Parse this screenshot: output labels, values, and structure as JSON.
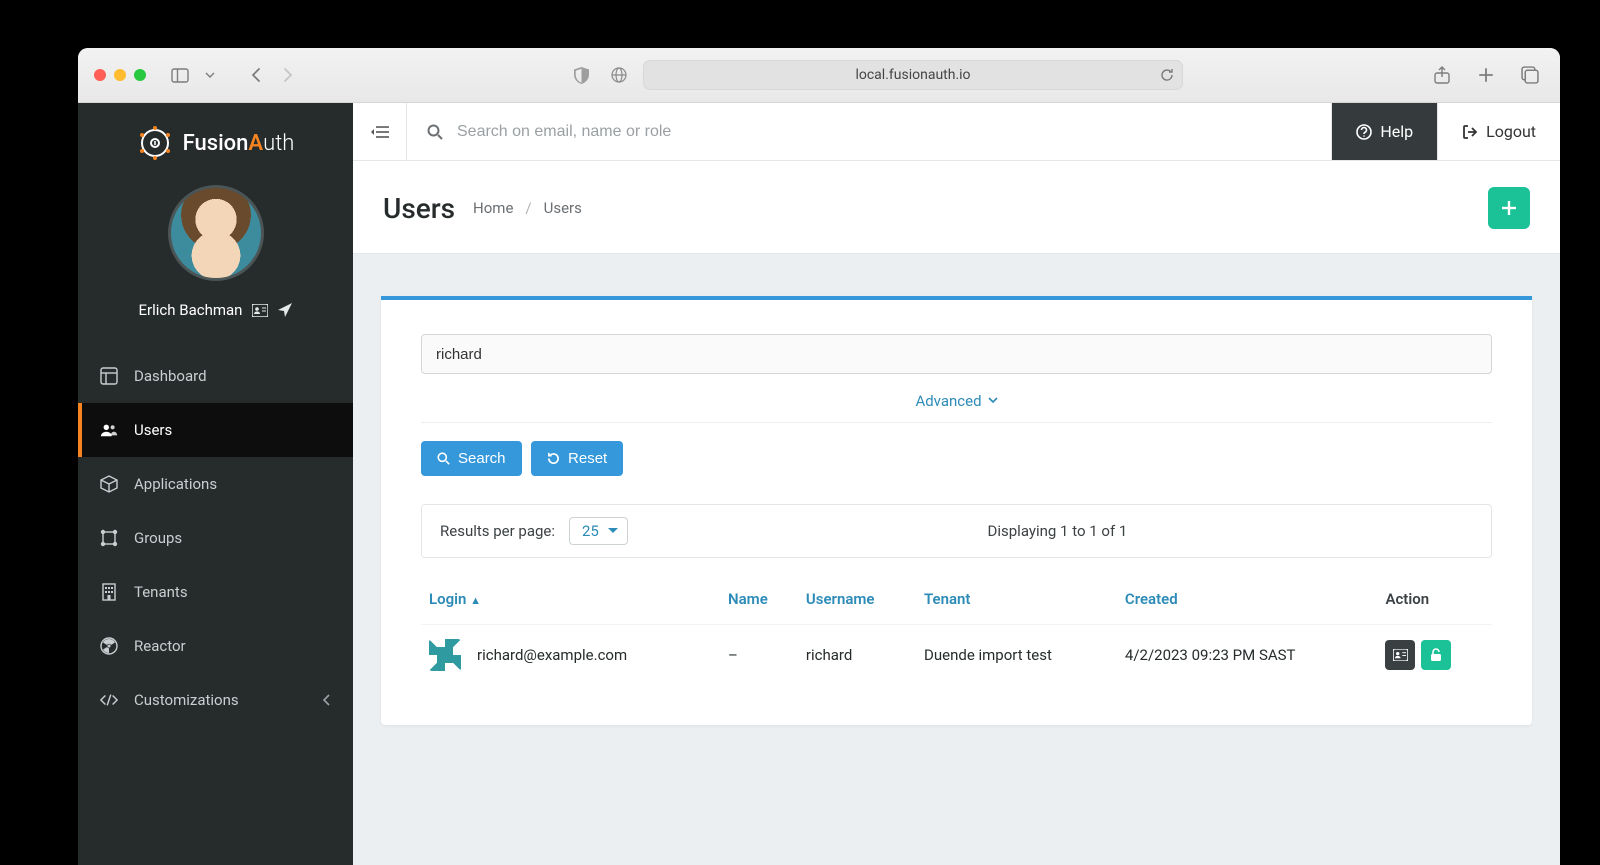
{
  "browser": {
    "address": "local.fusionauth.io"
  },
  "brand": {
    "name_a": "Fusion",
    "name_b": "A",
    "name_c": "uth"
  },
  "profile": {
    "name": "Erlich Bachman"
  },
  "sidebar": {
    "items": [
      {
        "label": "Dashboard",
        "icon": "dashboard"
      },
      {
        "label": "Users",
        "icon": "users",
        "active": true
      },
      {
        "label": "Applications",
        "icon": "cube"
      },
      {
        "label": "Groups",
        "icon": "groups"
      },
      {
        "label": "Tenants",
        "icon": "building"
      },
      {
        "label": "Reactor",
        "icon": "reactor"
      },
      {
        "label": "Customizations",
        "icon": "code",
        "expandable": true
      }
    ]
  },
  "topbar": {
    "search_placeholder": "Search on email, name or role",
    "help_label": "Help",
    "logout_label": "Logout"
  },
  "page": {
    "title": "Users",
    "breadcrumb_home": "Home",
    "breadcrumb_current": "Users"
  },
  "search": {
    "value": "richard",
    "advanced_label": "Advanced",
    "search_btn": "Search",
    "reset_btn": "Reset"
  },
  "pager": {
    "label": "Results per page:",
    "page_size": "25",
    "displaying": "Displaying 1 to 1 of 1"
  },
  "table": {
    "headers": {
      "login": "Login",
      "name": "Name",
      "username": "Username",
      "tenant": "Tenant",
      "created": "Created",
      "action": "Action"
    },
    "rows": [
      {
        "login": "richard@example.com",
        "name": "–",
        "username": "richard",
        "tenant": "Duende import test",
        "created": "4/2/2023 09:23 PM SAST"
      }
    ]
  }
}
